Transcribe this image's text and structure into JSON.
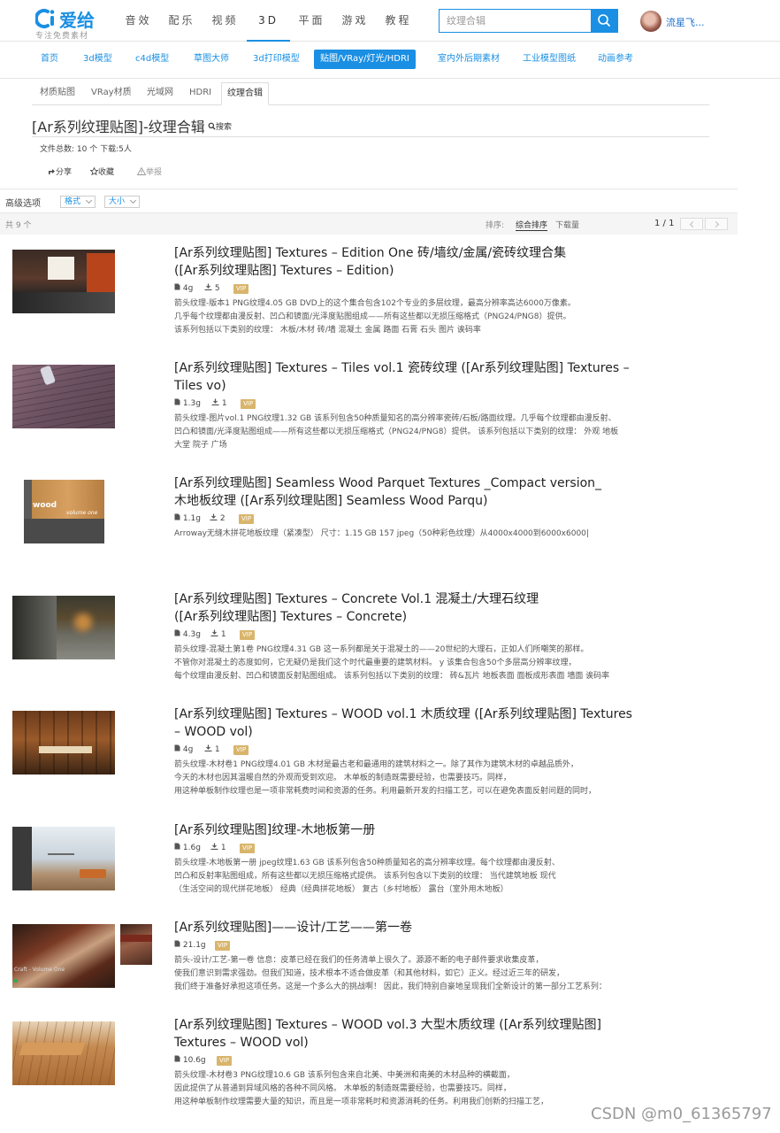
{
  "header": {
    "logo_text": "爱给",
    "logo_slogan": "专注免费素材",
    "nav": [
      "音效",
      "配乐",
      "视频",
      "3D",
      "平面",
      "游戏",
      "教程"
    ],
    "active_nav": "3D",
    "search_placeholder": "纹理合辑",
    "username": "流星飞..."
  },
  "subnav": [
    "首页",
    "3d模型",
    "c4d模型",
    "草图大师",
    "3d打印模型",
    "贴图/VRay/灯光/HDRI",
    "室内外后期素材",
    "工业模型图纸",
    "动画参考"
  ],
  "active_subnav": "贴图/VRay/灯光/HDRI",
  "category_tabs": [
    "材质贴图",
    "VRay材质",
    "光域网",
    "HDRI",
    "纹理合辑"
  ],
  "active_category": "纹理合辑",
  "page": {
    "title": "[Ar系列纹理贴图]-纹理合辑",
    "search_link": "搜索",
    "stats": "文件总数: 10 个   下载:5人",
    "share": "分享",
    "favorite": "收藏",
    "report": "举报"
  },
  "filters": {
    "label": "高级选项",
    "format": "格式",
    "size": "大小"
  },
  "results": {
    "count_text": "共 9 个",
    "sort_label": "排序:",
    "sort_options": [
      "综合排序",
      "下载量"
    ],
    "active_sort": "综合排序",
    "pager": "1 / 1"
  },
  "items": [
    {
      "title_line1": "[Ar系列纹理贴图] Textures – Edition One 砖/墙纹/金属/瓷砖纹理合集",
      "title_line2": "([Ar系列纹理贴图] Textures – Edition)",
      "size": "4g",
      "downloads": "5",
      "badge": "VIP",
      "desc": [
        "箭头纹理-版本1 PNG纹理4.05 GB DVD上的这个集合包含102个专业的多层纹理，最高分辨率高达6000万像素。",
        "几乎每个纹理都由漫反射、凹凸和镜面/光泽度贴图组成——所有这些都以无损压缩格式（PNG24/PNG8）提供。",
        "该系列包括以下类别的纹理： 木板/木材 砖/墙 混凝土 金属 路面 石膏 石头 图片 诶码率"
      ]
    },
    {
      "title_line1": "[Ar系列纹理贴图] Textures – Tiles vol.1 瓷砖纹理 ([Ar系列纹理贴图] Textures –",
      "title_line2": "Tiles vo)",
      "size": "1.3g",
      "downloads": "1",
      "badge": "VIP",
      "desc": [
        "箭头纹理-图片vol.1 PNG纹理1.32 GB 该系列包含50种质量知名的高分辨率瓷砖/石板/路面纹理。几乎每个纹理都由漫反射、",
        "凹凸和镜面/光泽度贴图组成——所有这些都以无损压缩格式（PNG24/PNG8）提供。 该系列包括以下类别的纹理： 外观 地板",
        "大堂 院子 广场"
      ]
    },
    {
      "title_line1": "[Ar系列纹理贴图] Seamless Wood Parquet Textures _Compact version_",
      "title_line2": "木地板纹理 ([Ar系列纹理贴图] Seamless Wood Parqu)",
      "size": "1.1g",
      "downloads": "2",
      "badge": "VIP",
      "thumb_caption1": "wood",
      "thumb_caption2": "volume one",
      "desc": [
        "Arroway无缝木拼花地板纹理（紧凑型） 尺寸：1.15 GB 157 jpeg（50种彩色纹理）从4000x4000到6000x6000|"
      ]
    },
    {
      "title_line1": "[Ar系列纹理贴图] Textures – Concrete Vol.1 混凝土/大理石纹理",
      "title_line2": "([Ar系列纹理贴图] Textures – Concrete)",
      "size": "4.3g",
      "downloads": "1",
      "badge": "VIP",
      "desc": [
        "箭头纹理-混凝土第1卷 PNG纹理4.31 GB 这一系列都是关于混凝土的——20世纪的大理石，正如人们所嘲笑的那样。",
        "不管你对混凝土的态度如何，它无疑仍是我们这个时代最重要的建筑材料。 y 该集合包含50个多层高分辨率纹理，",
        "每个纹理由漫反射、凹凸和镜面反射贴图组成。 该系列包括以下类别的纹理： 砖&瓦片 地板表面 面板成形表面 墙面 诶码率"
      ]
    },
    {
      "title_line1": "[Ar系列纹理贴图] Textures – WOOD vol.1 木质纹理 ([Ar系列纹理贴图] Textures",
      "title_line2": "– WOOD vol)",
      "size": "4g",
      "downloads": "1",
      "badge": "VIP",
      "desc": [
        "箭头纹理-木材卷1 PNG纹理4.01 GB 木材是最古老和最通用的建筑材料之一。除了其作为建筑木材的卓越品质外，",
        "今天的木材也因其温暖自然的外观而受到欢迎。 木单板的制造既需要经验，也需要技巧。同样，",
        "用这种单板制作纹理也是一项非常耗费时间和资源的任务。利用最新开发的扫描工艺，可以在避免表面反射问题的同时，"
      ]
    },
    {
      "title_line1": "[Ar系列纹理贴图]纹理-木地板第一册",
      "title_line2": "",
      "size": "1.6g",
      "downloads": "1",
      "badge": "VIP",
      "desc": [
        "箭头纹理-木地板第一册 jpeg纹理1.63 GB 该系列包含50种质量知名的高分辨率纹理。每个纹理都由漫反射、",
        "凹凸和反射率贴图组成，所有这些都以无损压缩格式提供。 该系列包含以下类别的纹理： 当代建筑地板 现代",
        "（生活空间的现代拼花地板） 经典（经典拼花地板） 复古（乡村地板） 露台（室外用木地板）"
      ]
    },
    {
      "title_line1": "[Ar系列纹理贴图]——设计/工艺——第一卷",
      "title_line2": "",
      "size": "21.1g",
      "downloads": "",
      "badge": "VIP",
      "thumb_caption1": "Craft - Volume One",
      "desc": [
        "箭头-设计/工艺-第一卷 信息：皮革已经在我们的任务清单上很久了。源源不断的电子邮件要求收集皮革，",
        "使我们意识到需求强劲。但我们知道，技术根本不适合做皮革（和其他材料，如它）正义。经过近三年的研发，",
        "我们终于准备好承担这项任务。这是一个多么大的挑战啊！ 因此，我们特别自豪地呈现我们全新设计的第一部分工艺系列："
      ]
    },
    {
      "title_line1": "[Ar系列纹理贴图] Textures – WOOD vol.3 大型木质纹理 ([Ar系列纹理贴图]",
      "title_line2": "Textures – WOOD vol)",
      "size": "10.6g",
      "downloads": "",
      "badge": "VIP",
      "desc": [
        "箭头纹理-木材卷3 PNG纹理10.6 GB 该系列包含来自北美、中美洲和南美的木材品种的横截面，",
        "因此提供了从普通到异域风格的各种不同风格。 木单板的制造既需要经验，也需要技巧。同样，",
        "用这种单板制作纹理需要大量的知识，而且是一项非常耗时和资源消耗的任务。利用我们创新的扫描工艺，"
      ]
    }
  ],
  "watermark": "CSDN @m0_61365797",
  "colors": {
    "accent": "#1a8fe3",
    "vip": "#d9b56c"
  }
}
